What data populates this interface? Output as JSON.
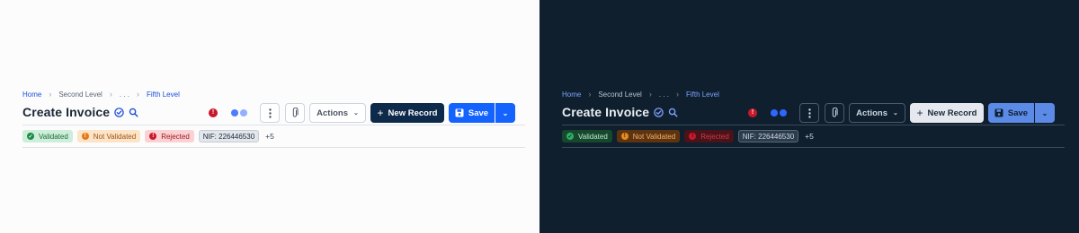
{
  "light": {
    "breadcrumb": [
      "Home",
      "Second Level",
      ". . .",
      "Fifth Level"
    ],
    "title": "Create Invoice",
    "error_indicator": "!",
    "buttons": {
      "more": "more-vertical-icon",
      "attach": "paperclip-icon",
      "actions": "Actions",
      "new_record": "New Record",
      "save": "Save"
    },
    "badges": [
      {
        "label": "Validated",
        "status": "success"
      },
      {
        "label": "Not Validated",
        "status": "warning"
      },
      {
        "label": "Rejected",
        "status": "error"
      }
    ],
    "nif": "NIF: 226446530",
    "more_badges": "+5"
  },
  "dark": {
    "breadcrumb": [
      "Home",
      "Second Level",
      ". . .",
      "Fifth Level"
    ],
    "title": "Create Invoice",
    "error_indicator": "!",
    "buttons": {
      "more": "more-vertical-icon",
      "attach": "paperclip-icon",
      "actions": "Actions",
      "new_record": "New Record",
      "save": "Save"
    },
    "badges": [
      {
        "label": "Validated",
        "status": "success"
      },
      {
        "label": "Not Validated",
        "status": "warning"
      },
      {
        "label": "Rejected",
        "status": "error"
      }
    ],
    "nif": "NIF: 226446530",
    "more_badges": "+5"
  },
  "colors": {
    "brand_navy": "#0d2a4a",
    "primary_blue": "#1463ff",
    "success": "#1f8a48",
    "warning": "#e47a13",
    "error": "#c8192b"
  }
}
